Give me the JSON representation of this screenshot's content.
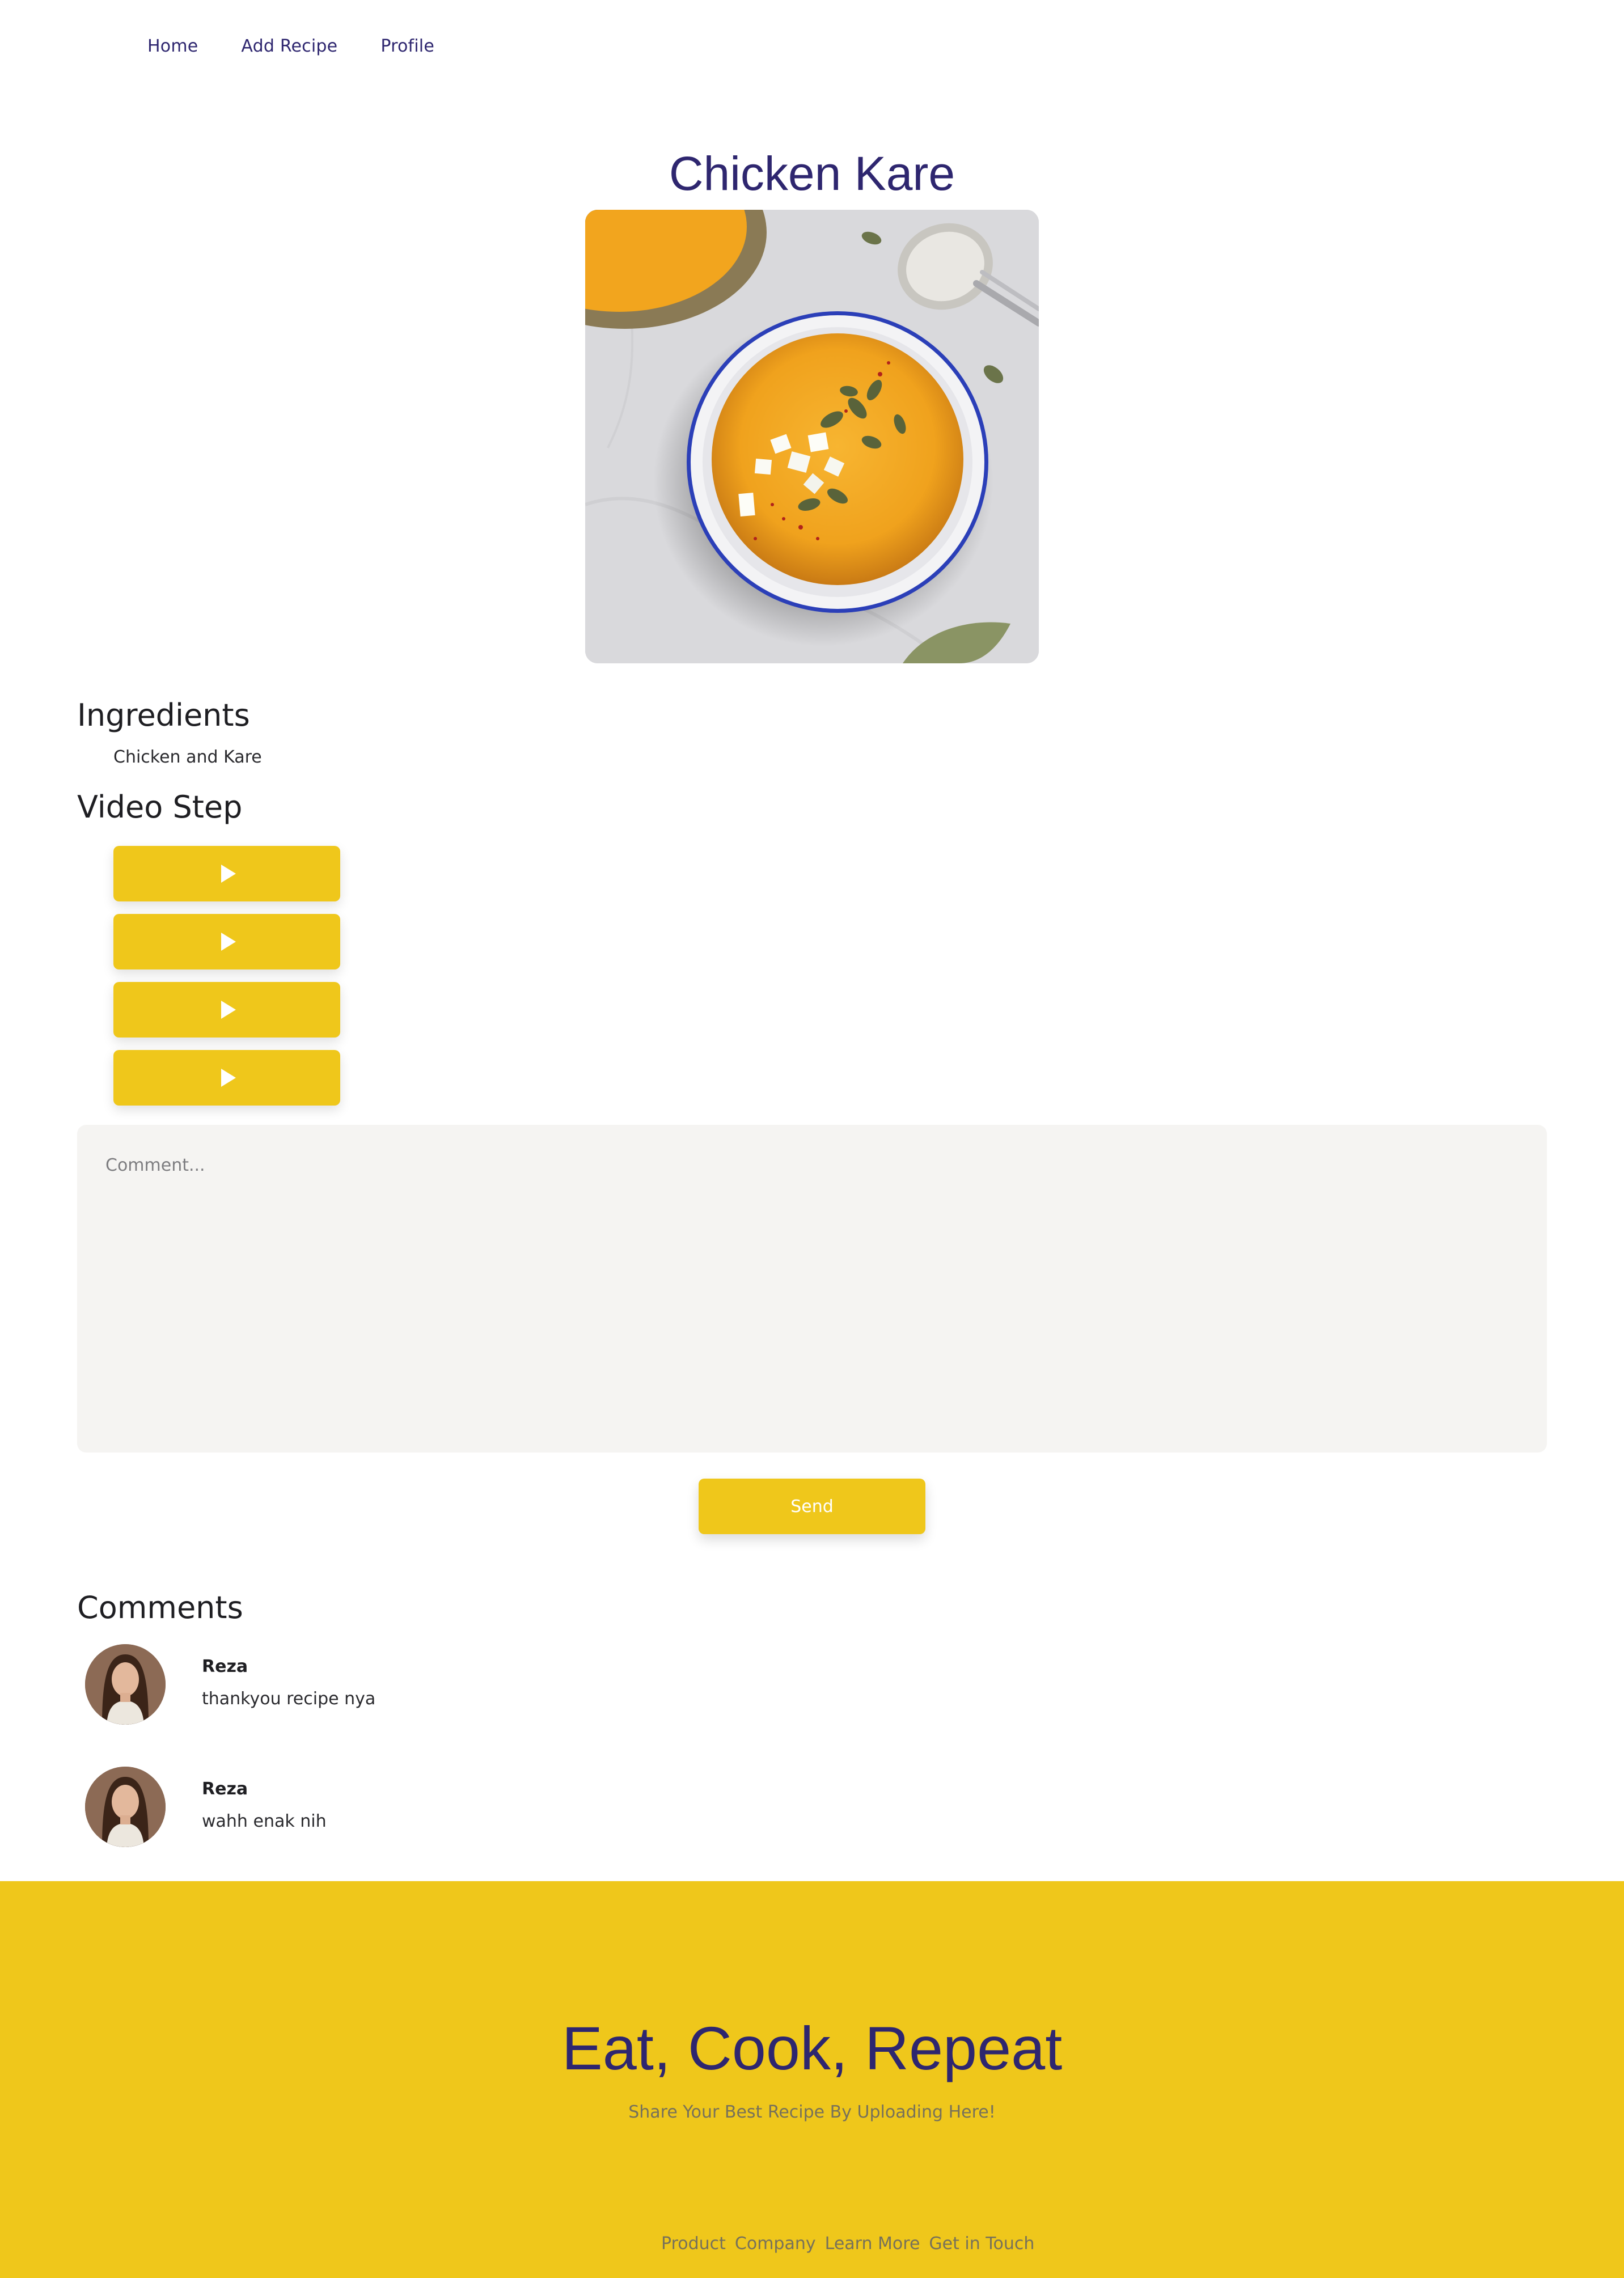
{
  "nav": {
    "items": [
      {
        "label": "Home"
      },
      {
        "label": "Add Recipe"
      },
      {
        "label": "Profile"
      }
    ]
  },
  "recipe": {
    "title": "Chicken Kare",
    "image_alt": "bowl of orange soup with pumpkin seeds",
    "ingredients_heading": "Ingredients",
    "ingredients": [
      "Chicken and Kare"
    ],
    "video_heading": "Video Step",
    "video_steps_count": 4
  },
  "comment_form": {
    "placeholder": "Comment...",
    "send_label": "Send"
  },
  "comments": {
    "heading": "Comments",
    "items": [
      {
        "name": "Reza",
        "text": "thankyou recipe nya"
      },
      {
        "name": "Reza",
        "text": "wahh enak nih"
      }
    ]
  },
  "footer": {
    "title": "Eat, Cook, Repeat",
    "subtitle": "Share Your Best Recipe By Uploading Here!",
    "links": [
      "Product",
      "Company",
      "Learn More",
      "Get in Touch"
    ]
  },
  "colors": {
    "accent": "#efc71b",
    "brand": "#2e266f",
    "comment_bg": "#f5f4f2"
  },
  "icons": [
    "play-icon"
  ]
}
